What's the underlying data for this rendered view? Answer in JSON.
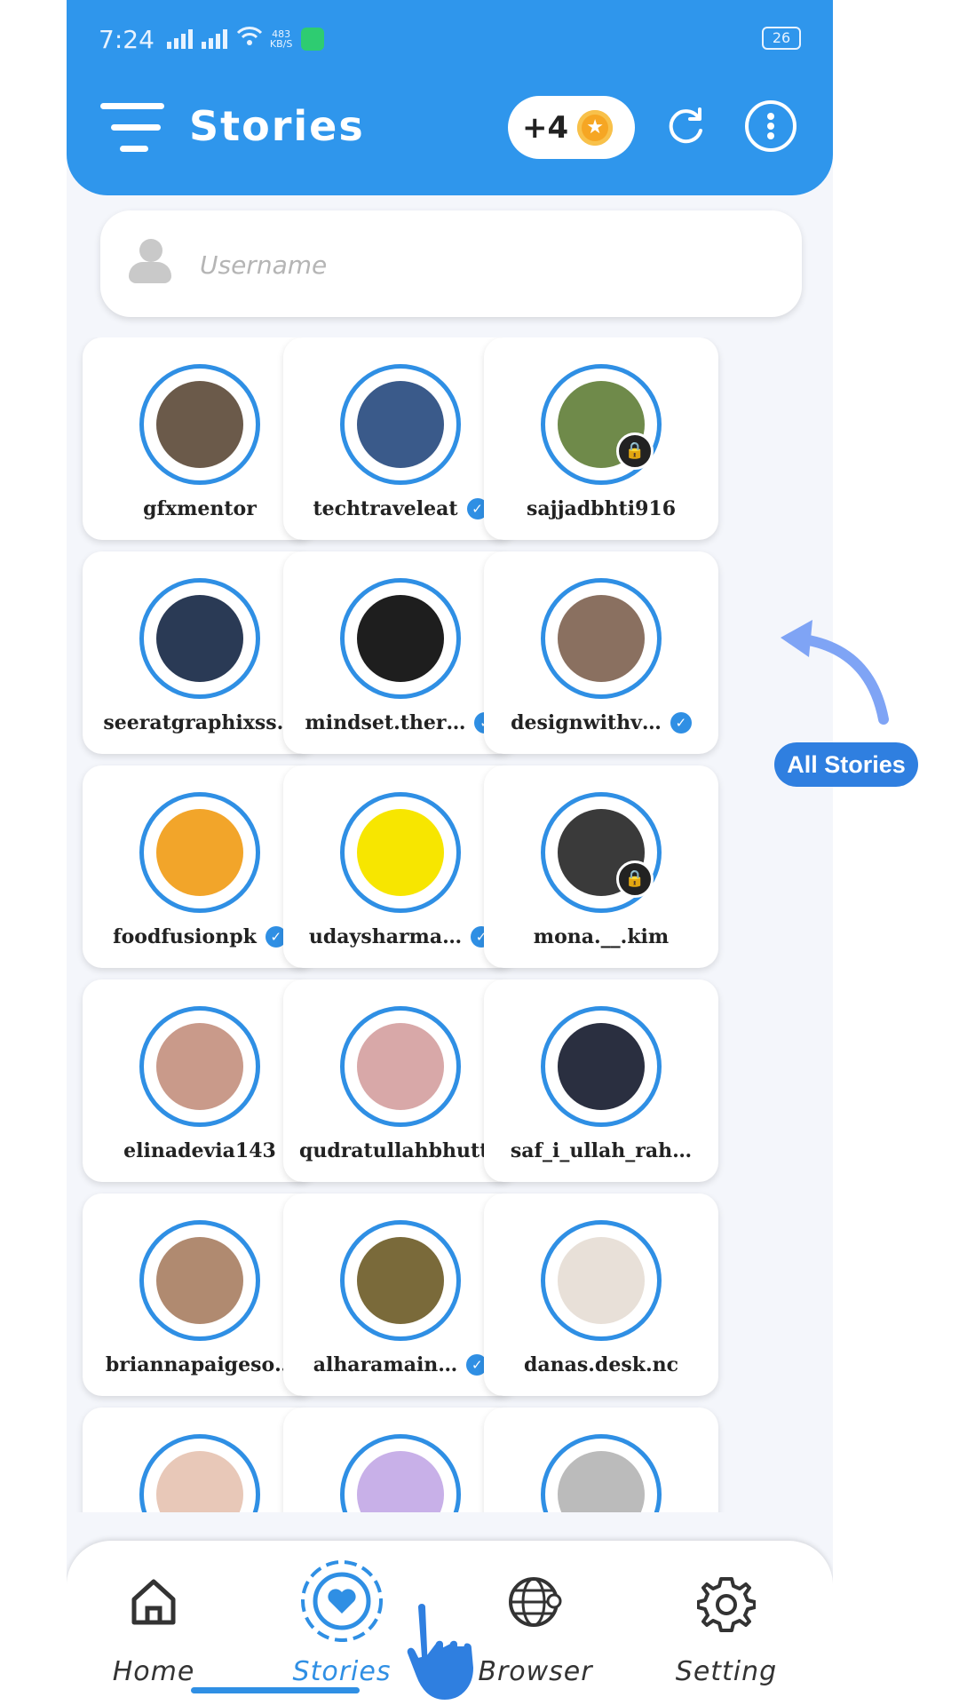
{
  "status_bar": {
    "time": "7:24",
    "speed_value": "483",
    "speed_unit": "KB/S",
    "battery": "26"
  },
  "header": {
    "title": "Stories",
    "coins": "+4"
  },
  "search": {
    "placeholder": "Username"
  },
  "stories": [
    {
      "username": "gfxmentor",
      "verified": false,
      "locked": false,
      "avatar_color": "#6b5a4a"
    },
    {
      "username": "techtraveleat",
      "verified": true,
      "locked": false,
      "avatar_color": "#3a5a8a"
    },
    {
      "username": "sajjadbhti916",
      "verified": false,
      "locked": true,
      "avatar_color": "#6f8a4a"
    },
    {
      "username": "seeratgraphixss…",
      "verified": false,
      "locked": false,
      "avatar_color": "#2a3a55"
    },
    {
      "username": "mindset.ther…",
      "verified": true,
      "locked": false,
      "avatar_color": "#1e1e1e"
    },
    {
      "username": "designwithv…",
      "verified": true,
      "locked": false,
      "avatar_color": "#8a7060"
    },
    {
      "username": "foodfusionpk",
      "verified": true,
      "locked": false,
      "avatar_color": "#f2a52a"
    },
    {
      "username": "udaysharma…",
      "verified": true,
      "locked": false,
      "avatar_color": "#f7e600"
    },
    {
      "username": "mona.__.kim",
      "verified": false,
      "locked": true,
      "avatar_color": "#3a3a3a"
    },
    {
      "username": "elinadevia143",
      "verified": false,
      "locked": false,
      "avatar_color": "#c99a8a"
    },
    {
      "username": "qudratullahbhutto",
      "verified": false,
      "locked": false,
      "avatar_color": "#d8a8a8"
    },
    {
      "username": "saf_i_ullah_rah…",
      "verified": false,
      "locked": false,
      "avatar_color": "#2a2f40"
    },
    {
      "username": "briannapaigeso…",
      "verified": false,
      "locked": false,
      "avatar_color": "#b08a70"
    },
    {
      "username": "alharamain…",
      "verified": true,
      "locked": false,
      "avatar_color": "#7a6a3a"
    },
    {
      "username": "danas.desk.nc",
      "verified": false,
      "locked": false,
      "avatar_color": "#e8e0d8"
    },
    {
      "username": "",
      "verified": false,
      "locked": false,
      "avatar_color": "#e8c8b8"
    },
    {
      "username": "",
      "verified": false,
      "locked": false,
      "avatar_color": "#c8b0e8"
    },
    {
      "username": "",
      "verified": false,
      "locked": false,
      "avatar_color": "#bbbbbb"
    }
  ],
  "callout": {
    "label": "All Stories"
  },
  "bottom_nav": [
    {
      "label": "Home",
      "icon": "home-icon",
      "active": false
    },
    {
      "label": "Stories",
      "icon": "stories-heart-icon",
      "active": true
    },
    {
      "label": "Browser",
      "icon": "globe-icon",
      "active": false
    },
    {
      "label": "Setting",
      "icon": "gear-icon",
      "active": false
    }
  ],
  "colors": {
    "accent": "#2f96ec",
    "ring": "#2f8fe4",
    "background": "#f4f6fb"
  }
}
